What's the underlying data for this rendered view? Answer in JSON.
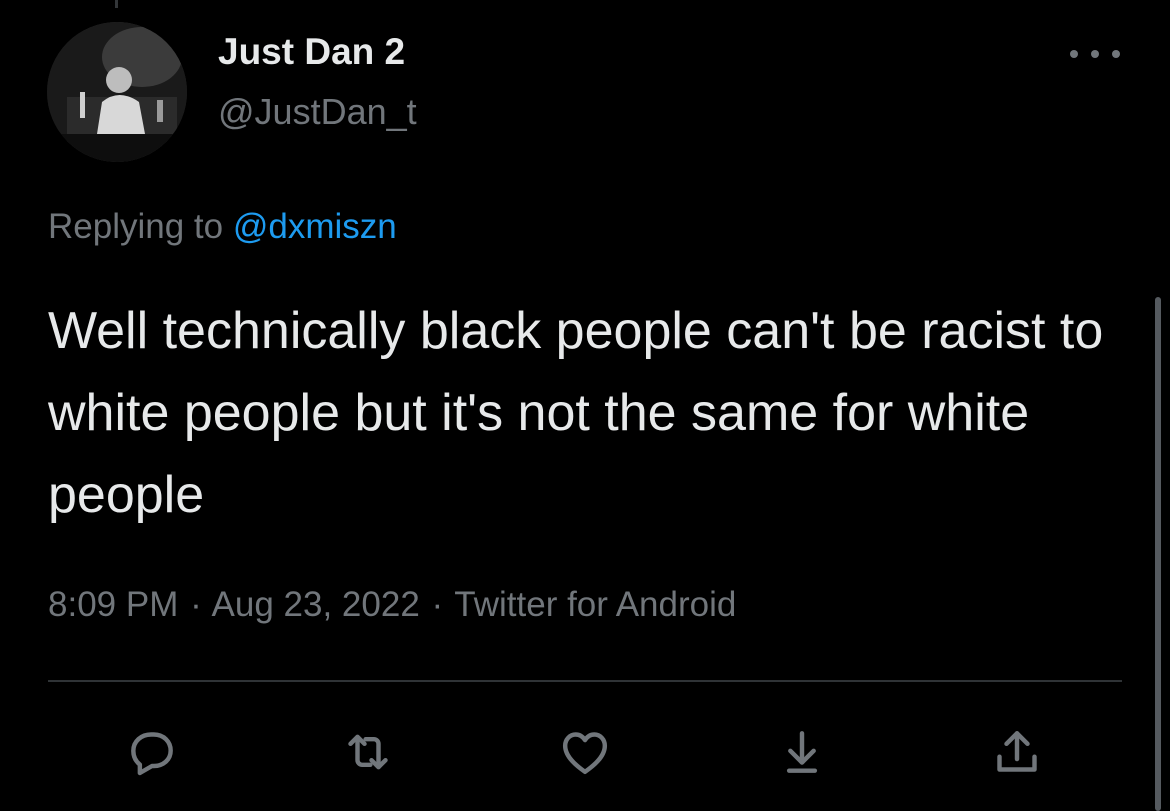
{
  "tweet": {
    "display_name": "Just Dan 2",
    "handle": "@JustDan_t",
    "replying_prefix": "Replying to",
    "replying_mention": "@dxmiszn",
    "text": "Well technically black people can't be racist to white people but it's not the same for white people",
    "time": "8:09 PM",
    "separator": "·",
    "date": "Aug 23, 2022",
    "source": "Twitter for Android"
  },
  "icons": {
    "avatar": "profile-photo",
    "more": "more-horizontal-icon",
    "reply": "reply-icon",
    "retweet": "retweet-icon",
    "like": "like-icon",
    "bookmark": "download-arrow-icon",
    "share": "share-icon"
  },
  "colors": {
    "background": "#000000",
    "primary_text": "#e7e9ea",
    "secondary_text": "#71767b",
    "accent": "#1d9bf0",
    "divider": "#2f3336"
  }
}
